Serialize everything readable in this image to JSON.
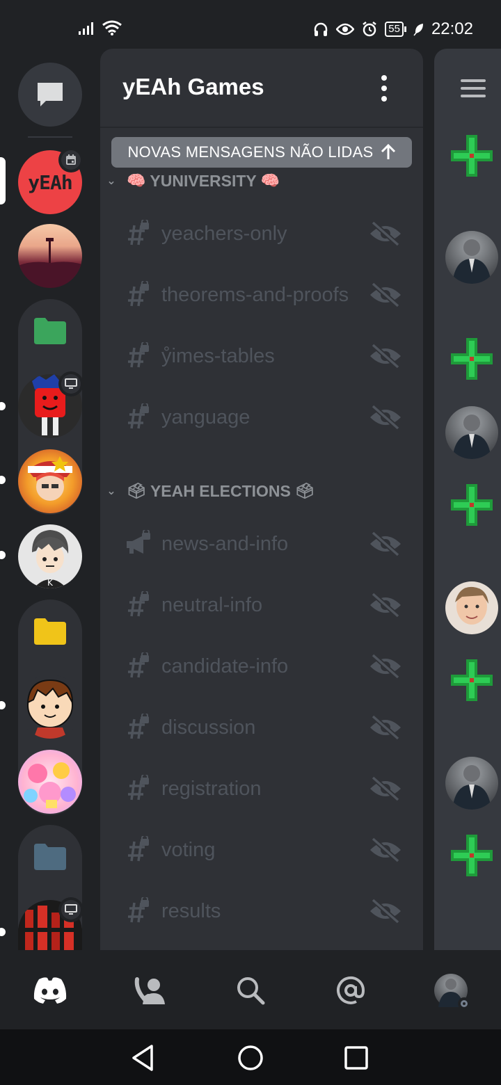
{
  "status_bar": {
    "time": "22:02",
    "battery": "55",
    "icons": [
      "signal-icon",
      "wifi-icon",
      "headphones-icon",
      "eye-icon",
      "alarm-icon",
      "battery-icon",
      "leaf-icon"
    ]
  },
  "server_rail": {
    "servers": [
      {
        "name": "yEAh Games",
        "logo_text": "yEAh",
        "selected": true
      },
      {
        "name": "sunset-server"
      },
      {
        "name": "green-folder"
      },
      {
        "name": "red-character-server"
      },
      {
        "name": "anime-avatar-server"
      },
      {
        "name": "grey-hair-avatar-server"
      },
      {
        "name": "yellow-folder"
      },
      {
        "name": "brown-hair-avatar-server"
      },
      {
        "name": "anime-collage-server"
      },
      {
        "name": "blue-folder"
      },
      {
        "name": "red-poster-server"
      }
    ]
  },
  "channel_panel": {
    "guild_name": "yEAh Games",
    "unread_banner": "NOVAS MENSAGENS NÃO LIDAS",
    "categories": [
      {
        "name": "YUNIVERSITY",
        "emoji": "🧠",
        "channels": [
          {
            "name": "yeachers-only",
            "type": "text-locked"
          },
          {
            "name": "theorems-and-proofs",
            "type": "text-locked"
          },
          {
            "name": "ẙimes-tables",
            "type": "text-locked"
          },
          {
            "name": "yanguage",
            "type": "text-locked"
          }
        ]
      },
      {
        "name": "YEAH ELECTIONS",
        "emoji": "🗳",
        "channels": [
          {
            "name": "news-and-info",
            "type": "announcement-locked"
          },
          {
            "name": "neutral-info",
            "type": "text-locked"
          },
          {
            "name": "candidate-info",
            "type": "text-locked"
          },
          {
            "name": "discussion",
            "type": "text-locked"
          },
          {
            "name": "registration",
            "type": "text-locked"
          },
          {
            "name": "voting",
            "type": "text-locked"
          },
          {
            "name": "results",
            "type": "text-locked"
          }
        ]
      }
    ]
  },
  "bottom_nav": {
    "items": [
      "discord-home-icon",
      "friends-icon",
      "search-icon",
      "mentions-icon",
      "profile-avatar"
    ]
  },
  "system_nav": {
    "items": [
      "back-icon",
      "home-icon",
      "recents-icon"
    ]
  },
  "colors": {
    "background": "#202225",
    "panel": "#2f3136",
    "channel_muted": "#4f545c",
    "category": "#8e9297",
    "banner": "#72767d",
    "accent_red": "#ed4245",
    "folder_green": "#3ba55c",
    "folder_yellow": "#f0c419",
    "folder_blue": "#4e6b80"
  }
}
